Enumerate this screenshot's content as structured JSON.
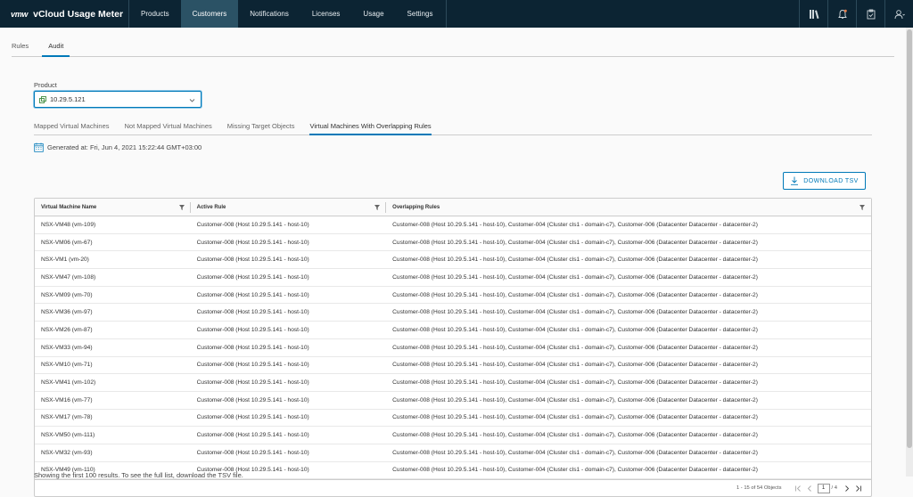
{
  "header": {
    "logo": "vmw",
    "title": "vCloud Usage Meter",
    "nav": [
      {
        "label": "Products"
      },
      {
        "label": "Customers"
      },
      {
        "label": "Notifications"
      },
      {
        "label": "Licenses"
      },
      {
        "label": "Usage"
      },
      {
        "label": "Settings"
      }
    ],
    "active_nav": "Customers",
    "accent": "#0c2433"
  },
  "top_tabs": [
    {
      "label": "Rules"
    },
    {
      "label": "Audit"
    }
  ],
  "product": {
    "label": "Product",
    "value": "10.29.5.121"
  },
  "sub_tabs": [
    {
      "label": "Mapped Virtual Machines"
    },
    {
      "label": "Not Mapped Virtual Machines"
    },
    {
      "label": "Missing Target Objects"
    },
    {
      "label": "Virtual Machines With Overlapping Rules"
    }
  ],
  "generated": "Generated at: Fri, Jun 4, 2021 15:22:44 GMT+03:00",
  "download_label": "DOWNLOAD TSV",
  "table": {
    "columns": [
      "Virtual Machine Name",
      "Active Rule",
      "Overlapping Rules"
    ],
    "rows": [
      [
        "NSX-VM48 (vm-109)",
        "Customer-008 (Host 10.29.5.141 - host-10)",
        "Customer-008 (Host 10.29.5.141 - host-10), Customer-004 (Cluster cls1 - domain-c7), Customer-006 (Datacenter Datacenter - datacenter-2)"
      ],
      [
        "NSX-VM06 (vm-67)",
        "Customer-008 (Host 10.29.5.141 - host-10)",
        "Customer-008 (Host 10.29.5.141 - host-10), Customer-004 (Cluster cls1 - domain-c7), Customer-006 (Datacenter Datacenter - datacenter-2)"
      ],
      [
        "NSX-VM1 (vm-20)",
        "Customer-008 (Host 10.29.5.141 - host-10)",
        "Customer-008 (Host 10.29.5.141 - host-10), Customer-004 (Cluster cls1 - domain-c7), Customer-006 (Datacenter Datacenter - datacenter-2)"
      ],
      [
        "NSX-VM47 (vm-108)",
        "Customer-008 (Host 10.29.5.141 - host-10)",
        "Customer-008 (Host 10.29.5.141 - host-10), Customer-004 (Cluster cls1 - domain-c7), Customer-006 (Datacenter Datacenter - datacenter-2)"
      ],
      [
        "NSX-VM09 (vm-70)",
        "Customer-008 (Host 10.29.5.141 - host-10)",
        "Customer-008 (Host 10.29.5.141 - host-10), Customer-004 (Cluster cls1 - domain-c7), Customer-006 (Datacenter Datacenter - datacenter-2)"
      ],
      [
        "NSX-VM36 (vm-97)",
        "Customer-008 (Host 10.29.5.141 - host-10)",
        "Customer-008 (Host 10.29.5.141 - host-10), Customer-004 (Cluster cls1 - domain-c7), Customer-006 (Datacenter Datacenter - datacenter-2)"
      ],
      [
        "NSX-VM26 (vm-87)",
        "Customer-008 (Host 10.29.5.141 - host-10)",
        "Customer-008 (Host 10.29.5.141 - host-10), Customer-004 (Cluster cls1 - domain-c7), Customer-006 (Datacenter Datacenter - datacenter-2)"
      ],
      [
        "NSX-VM33 (vm-94)",
        "Customer-008 (Host 10.29.5.141 - host-10)",
        "Customer-008 (Host 10.29.5.141 - host-10), Customer-004 (Cluster cls1 - domain-c7), Customer-006 (Datacenter Datacenter - datacenter-2)"
      ],
      [
        "NSX-VM10 (vm-71)",
        "Customer-008 (Host 10.29.5.141 - host-10)",
        "Customer-008 (Host 10.29.5.141 - host-10), Customer-004 (Cluster cls1 - domain-c7), Customer-006 (Datacenter Datacenter - datacenter-2)"
      ],
      [
        "NSX-VM41 (vm-102)",
        "Customer-008 (Host 10.29.5.141 - host-10)",
        "Customer-008 (Host 10.29.5.141 - host-10), Customer-004 (Cluster cls1 - domain-c7), Customer-006 (Datacenter Datacenter - datacenter-2)"
      ],
      [
        "NSX-VM16 (vm-77)",
        "Customer-008 (Host 10.29.5.141 - host-10)",
        "Customer-008 (Host 10.29.5.141 - host-10), Customer-004 (Cluster cls1 - domain-c7), Customer-006 (Datacenter Datacenter - datacenter-2)"
      ],
      [
        "NSX-VM17 (vm-78)",
        "Customer-008 (Host 10.29.5.141 - host-10)",
        "Customer-008 (Host 10.29.5.141 - host-10), Customer-004 (Cluster cls1 - domain-c7), Customer-006 (Datacenter Datacenter - datacenter-2)"
      ],
      [
        "NSX-VM50 (vm-111)",
        "Customer-008 (Host 10.29.5.141 - host-10)",
        "Customer-008 (Host 10.29.5.141 - host-10), Customer-004 (Cluster cls1 - domain-c7), Customer-006 (Datacenter Datacenter - datacenter-2)"
      ],
      [
        "NSX-VM32 (vm-93)",
        "Customer-008 (Host 10.29.5.141 - host-10)",
        "Customer-008 (Host 10.29.5.141 - host-10), Customer-004 (Cluster cls1 - domain-c7), Customer-006 (Datacenter Datacenter - datacenter-2)"
      ],
      [
        "NSX-VM49 (vm-110)",
        "Customer-008 (Host 10.29.5.141 - host-10)",
        "Customer-008 (Host 10.29.5.141 - host-10), Customer-004 (Cluster cls1 - domain-c7), Customer-006 (Datacenter Datacenter - datacenter-2)"
      ]
    ]
  },
  "pagination": {
    "summary": "1 - 15 of 54 Objects",
    "current_page": "1",
    "total": "/ 4"
  },
  "footnote": "Showing the first 100 results. To see the full list, download the TSV file."
}
